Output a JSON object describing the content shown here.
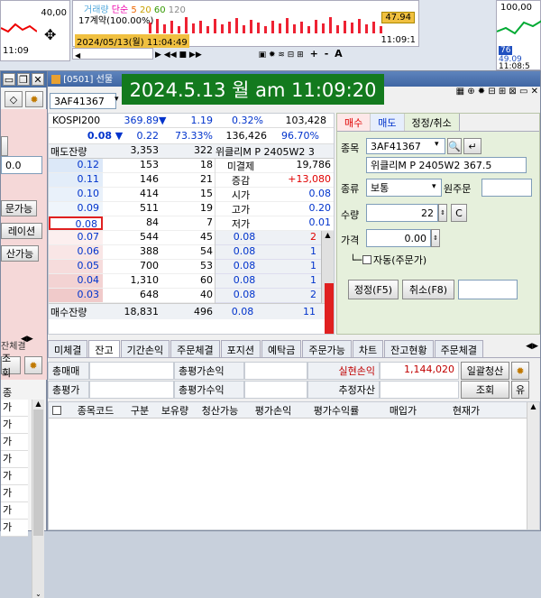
{
  "overlay_timestamp": "2024.5.13 월 am 11:09:20",
  "top_chart": {
    "left_price": "40,00",
    "left_time": "11:09",
    "legend": {
      "volume": "거래량",
      "ma_label": "단순",
      "ma_values": [
        "5",
        "20",
        "60",
        "120"
      ]
    },
    "contract_label": "17계약(100.00%)",
    "price_badge": "47.94",
    "time_right": "11:09:1",
    "date_stamp": "2024/05/13(월) 11:04:49",
    "right_price": "100,00",
    "right_values": [
      "76",
      "49.09"
    ],
    "right_time": "11:08:5",
    "nav_plus": "+",
    "nav_minus": "-",
    "nav_a": "A"
  },
  "order_window": {
    "title": "[0501] 선물",
    "code": "3AF41367",
    "kospi": {
      "label": "KOSPI200",
      "value": "369.89",
      "arrow": "▼",
      "change": "1.19",
      "pct": "0.32%",
      "volume": "103,428"
    },
    "summary": {
      "arrow": "▼",
      "price": "0.08",
      "change": "0.22",
      "pct": "73.33%",
      "volume": "136,426",
      "ratio": "96.70%"
    },
    "headers": {
      "sell_qty": "매도잔량",
      "sell_total": "3,353",
      "cnt": "322",
      "name": "위클리M P 2405W2 3"
    },
    "sell_rows": [
      {
        "price": "0.12",
        "qty": "153",
        "cnt": "18"
      },
      {
        "price": "0.11",
        "qty": "146",
        "cnt": "21"
      },
      {
        "price": "0.10",
        "qty": "414",
        "cnt": "15"
      },
      {
        "price": "0.09",
        "qty": "511",
        "cnt": "19"
      },
      {
        "price": "0.08",
        "qty": "84",
        "cnt": "7"
      }
    ],
    "info_rows": [
      {
        "label": "미결제",
        "value": "19,786"
      },
      {
        "label": "증감",
        "value": "+13,080"
      },
      {
        "label": "시가",
        "value": "0.08"
      },
      {
        "label": "고가",
        "value": "0.20"
      },
      {
        "label": "저가",
        "value": "0.01"
      }
    ],
    "buy_rows": [
      {
        "price": "0.07",
        "qty": "544",
        "cnt": "45"
      },
      {
        "price": "0.06",
        "qty": "388",
        "cnt": "54"
      },
      {
        "price": "0.05",
        "qty": "700",
        "cnt": "53"
      },
      {
        "price": "0.04",
        "qty": "1,310",
        "cnt": "60"
      },
      {
        "price": "0.03",
        "qty": "648",
        "cnt": "40"
      }
    ],
    "ticks": [
      {
        "price": "0.08",
        "qty": "2"
      },
      {
        "price": "0.08",
        "qty": "1"
      },
      {
        "price": "0.08",
        "qty": "1"
      },
      {
        "price": "0.08",
        "qty": "1"
      },
      {
        "price": "0.08",
        "qty": "2"
      },
      {
        "price": "0.08",
        "qty": "11"
      }
    ],
    "footer": {
      "label": "매수잔량",
      "total": "18,831",
      "cnt": "496"
    },
    "order_tabs": [
      "매수",
      "매도",
      "정정/취소"
    ],
    "form": {
      "code_label": "종목",
      "code": "3AF41367",
      "name": "위클리M P 2405W2 367.5",
      "type_label": "종류",
      "type": "보통",
      "orig_label": "원주문",
      "qty_label": "수량",
      "qty": "22",
      "c_btn": "C",
      "price_label": "가격",
      "price": "0.00",
      "auto_label": "자동(주문가)",
      "modify_btn": "정정(F5)",
      "cancel_btn": "취소(F8)"
    },
    "bottom_tabs": [
      "미체결",
      "잔고",
      "기간손익",
      "주문체결",
      "포지션",
      "예탁금",
      "주문가능",
      "차트",
      "잔고현황",
      "주문체결"
    ],
    "balance": {
      "total_buy": "총매매",
      "total_eval": "총평가",
      "eval_pl": "총평가손익",
      "eval_rate": "총평가수익",
      "realized": "실현손익",
      "realized_value": "1,144,020",
      "est_asset": "추정자산",
      "close_all": "일괄청산",
      "query": "조회",
      "oo": "유"
    },
    "columns": [
      "종목코드",
      "구분",
      "보유량",
      "청산가능",
      "평가손익",
      "평가수익률",
      "매입가",
      "현재가"
    ]
  },
  "left_panel": {
    "buttons": [
      "문가능",
      "레이션",
      "산가능"
    ],
    "value": "0.0",
    "bottom_label": "잔체결",
    "query": "조회",
    "col": "종",
    "rows": [
      "가",
      "가",
      "가",
      "가",
      "가",
      "가",
      "가",
      "가"
    ]
  }
}
